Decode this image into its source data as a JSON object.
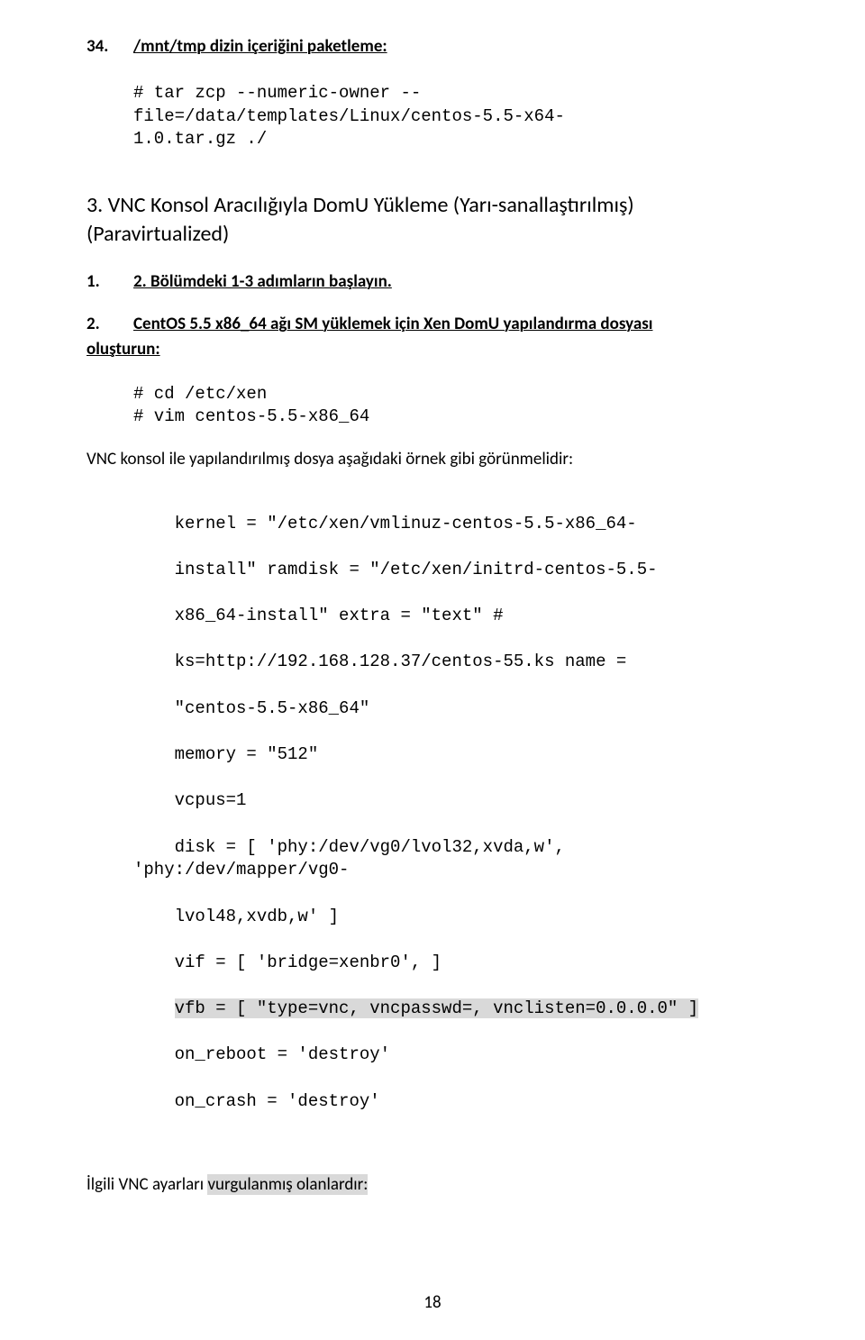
{
  "item34": {
    "number": "34.",
    "title": "/mnt/tmp  dizin içeriğini paketleme:"
  },
  "code1": "# tar zcp --numeric-owner --\nfile=/data/templates/Linux/centos-5.5-x64-\n1.0.tar.gz ./",
  "h3": "3.       VNC Konsol Aracılığıyla DomU Yükleme (Yarı-sanallaştırılmış) (Paravirtualized)",
  "step1": {
    "number": "1.",
    "text": "2. Bölümdeki 1-3 adımların başlayın."
  },
  "step2": {
    "number": "2.",
    "text_a": "CentOS  5.5  x86_64  ağı  SM  yüklemek  için  Xen  DomU  yapılandırma  dosyası",
    "text_b": "oluşturun:"
  },
  "code2": "# cd /etc/xen\n# vim centos-5.5-x86_64",
  "para1": "VNC konsol ile yapılandırılmış dosya aşağıdaki örnek gibi görünmelidir:",
  "code3_l1": "kernel = \"/etc/xen/vmlinuz-centos-5.5-x86_64-",
  "code3_l2": "install\" ramdisk = \"/etc/xen/initrd-centos-5.5-",
  "code3_l3": "x86_64-install\" extra = \"text\" #",
  "code3_l4": "ks=http://192.168.128.37/centos-55.ks name =",
  "code3_l5": "\"centos-5.5-x86_64\"",
  "code3_l6": "memory = \"512\"",
  "code3_l7": "vcpus=1",
  "code3_l8": "disk = [ 'phy:/dev/vg0/lvol32,xvda,w', 'phy:/dev/mapper/vg0-",
  "code3_l9": "lvol48,xvdb,w' ]",
  "code3_l10": "vif = [ 'bridge=xenbr0', ]",
  "code3_l11": "vfb = [ \"type=vnc, vncpasswd=, vnclisten=0.0.0.0\" ]",
  "code3_l12": "on_reboot = 'destroy'",
  "code3_l13": "on_crash = 'destroy'",
  "final_a": "İlgili VNC ayarları ",
  "final_hl": "vurgulanmış olanlardır:",
  "pagenum": "18"
}
